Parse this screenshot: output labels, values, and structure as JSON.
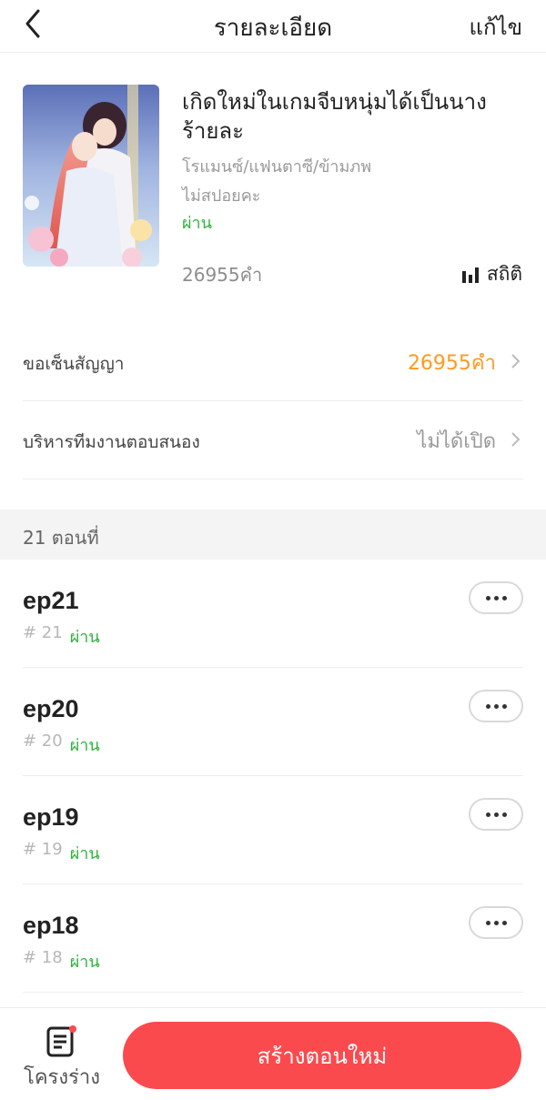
{
  "header": {
    "title": "รายละเอียด",
    "edit_label": "แก้ไข",
    "back_icon": "chevron-left-icon"
  },
  "book": {
    "title": "เกิดใหม่ในเกมจีบหนุ่มได้เป็นนางร้ายละ",
    "genres": "โรแมนซ์/แฟนตาซี/ข้ามภพ",
    "spoiler": "ไม่สปอยคะ",
    "status": "ผ่าน",
    "word_count": "26955คำ",
    "stats_label": "สถิติ",
    "status_color": "#2eb33b"
  },
  "settings": [
    {
      "label": "ขอเซ็นสัญญา",
      "value": "26955คำ",
      "value_color": "#ff9a1f"
    },
    {
      "label": "บริหารทีมงานตอบสนอง",
      "value": "ไม่ได้เปิด",
      "value_color": "#9a9a9a"
    }
  ],
  "chapters": {
    "count_label": "21 ตอนที่",
    "items": [
      {
        "title": "ep21",
        "number": "# 21",
        "status": "ผ่าน"
      },
      {
        "title": "ep20",
        "number": "# 20",
        "status": "ผ่าน"
      },
      {
        "title": "ep19",
        "number": "# 19",
        "status": "ผ่าน"
      },
      {
        "title": "ep18",
        "number": "# 18",
        "status": "ผ่าน"
      }
    ]
  },
  "footer": {
    "drafts_label": "โครงร่าง",
    "create_label": "สร้างตอนใหม่",
    "accent": "#fb4a4e"
  }
}
